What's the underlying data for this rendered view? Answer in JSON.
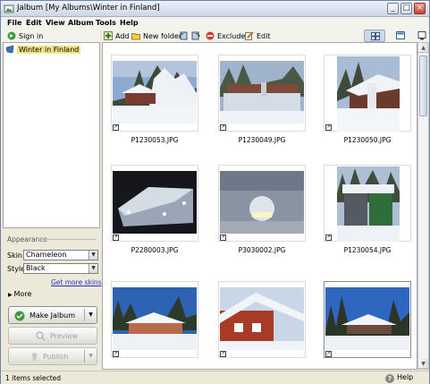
{
  "window": {
    "title": "Jalbum [My Albums\\Winter in Finland]",
    "buttons": {
      "minimize": "_",
      "maximize": "□",
      "close": "×"
    }
  },
  "menu": [
    "File",
    "Edit",
    "View",
    "Album",
    "Tools",
    "Help"
  ],
  "left_toolbar": {
    "sign_in": "Sign in"
  },
  "toolbar": {
    "add": "Add",
    "new_folder": "New folder",
    "exclude": "Exclude",
    "edit": "Edit"
  },
  "tree": {
    "root": "Winter in Finland"
  },
  "appearance": {
    "title": "Appearance",
    "skin_label": "Skin",
    "skin_value": "Chameleon",
    "style_label": "Style",
    "style_value": "Black",
    "get_more_skins": "Get more skins",
    "more": "More"
  },
  "actions": {
    "make_album": "Make Jalbum",
    "preview": "Preview",
    "publish": "Publish"
  },
  "images": [
    {
      "name": "P1230053.JPG"
    },
    {
      "name": "P1230049.JPG"
    },
    {
      "name": "P1230050.JPG"
    },
    {
      "name": "P2280003.JPG"
    },
    {
      "name": "P3030002.JPG"
    },
    {
      "name": "P1230054.JPG"
    },
    {
      "name": ""
    },
    {
      "name": ""
    },
    {
      "name": ""
    }
  ],
  "status": {
    "selection": "1 items selected",
    "help": "Help"
  }
}
